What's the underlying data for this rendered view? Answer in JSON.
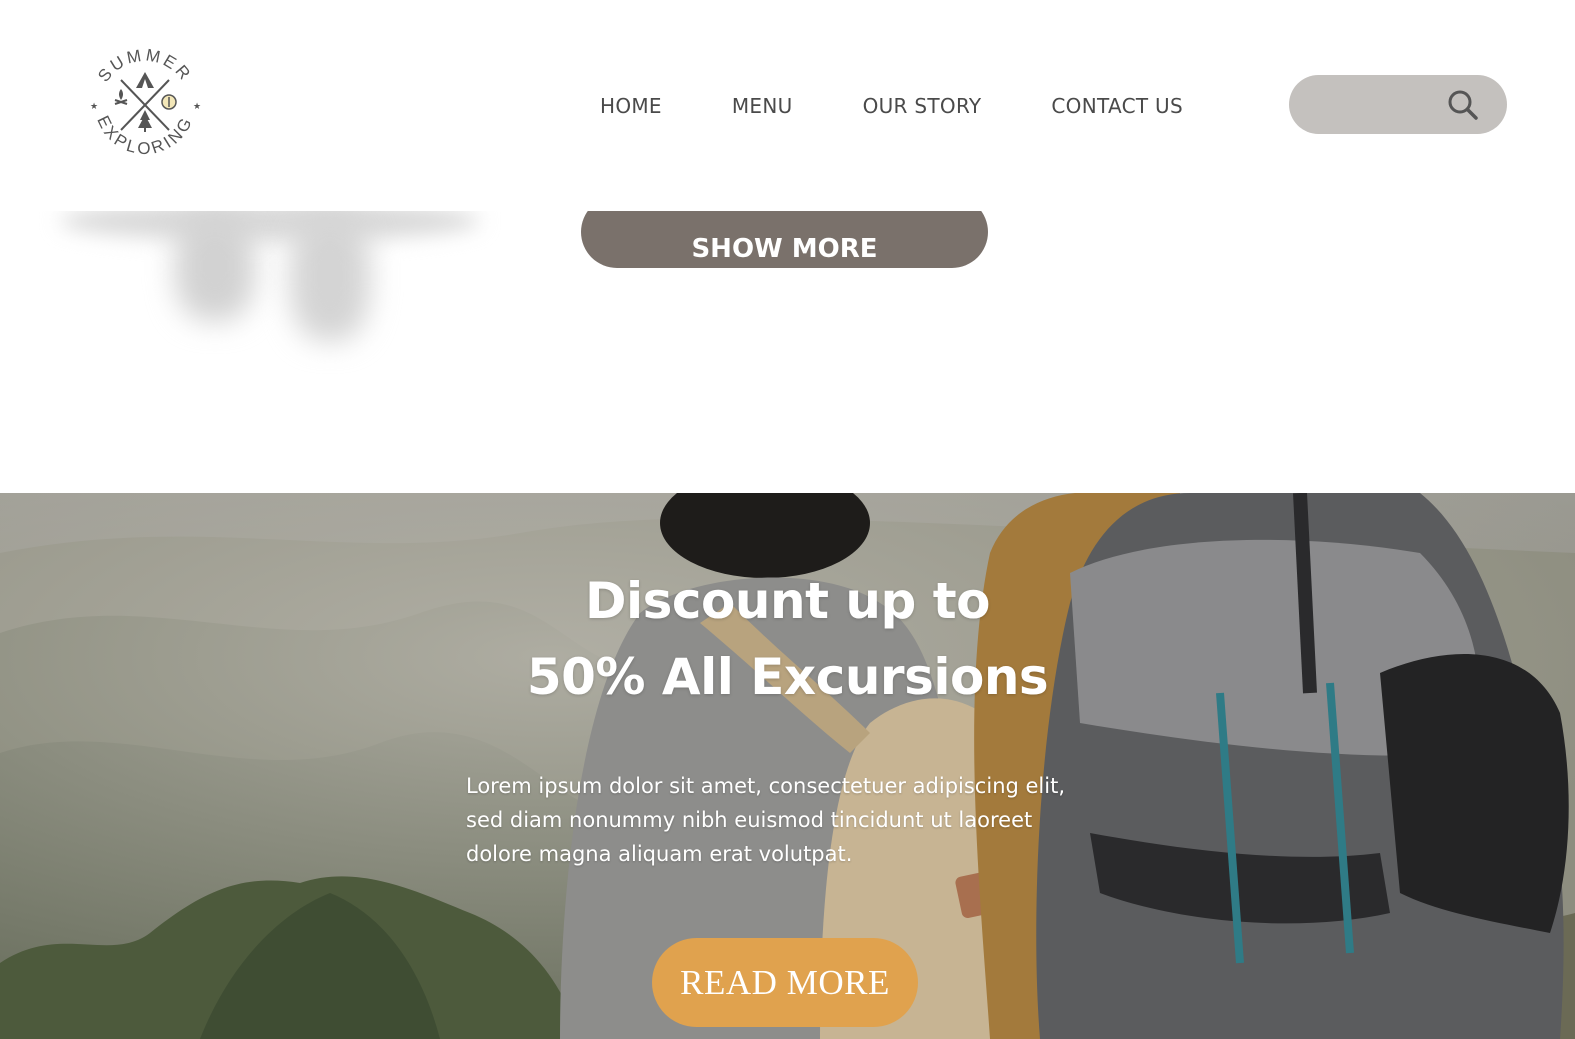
{
  "brand": {
    "logo_top_text": "SUMMER",
    "logo_bottom_text": "EXPLORING",
    "logo_color": "#555555"
  },
  "nav": {
    "items": [
      {
        "label": "HOME"
      },
      {
        "label": "MENU"
      },
      {
        "label": "OUR STORY"
      },
      {
        "label": "CONTACT US"
      }
    ]
  },
  "search": {
    "placeholder": "",
    "value": "",
    "icon": "search-icon",
    "background": "#c4c1be"
  },
  "section": {
    "show_more_label": "SHOW MORE",
    "show_more_color": "#7a716b"
  },
  "hero": {
    "title_line1": "Discount up to",
    "title_line2": "50% All Excursions",
    "body_line1": "Lorem ipsum dolor sit amet, consectetuer adipiscing elit,",
    "body_line2": "sed diam nonummy nibh euismod tincidunt ut laoreet",
    "body_line3": "dolore magna aliquam erat volutpat.",
    "read_more_label": "READ MORE",
    "read_more_color": "#e0a24e"
  }
}
